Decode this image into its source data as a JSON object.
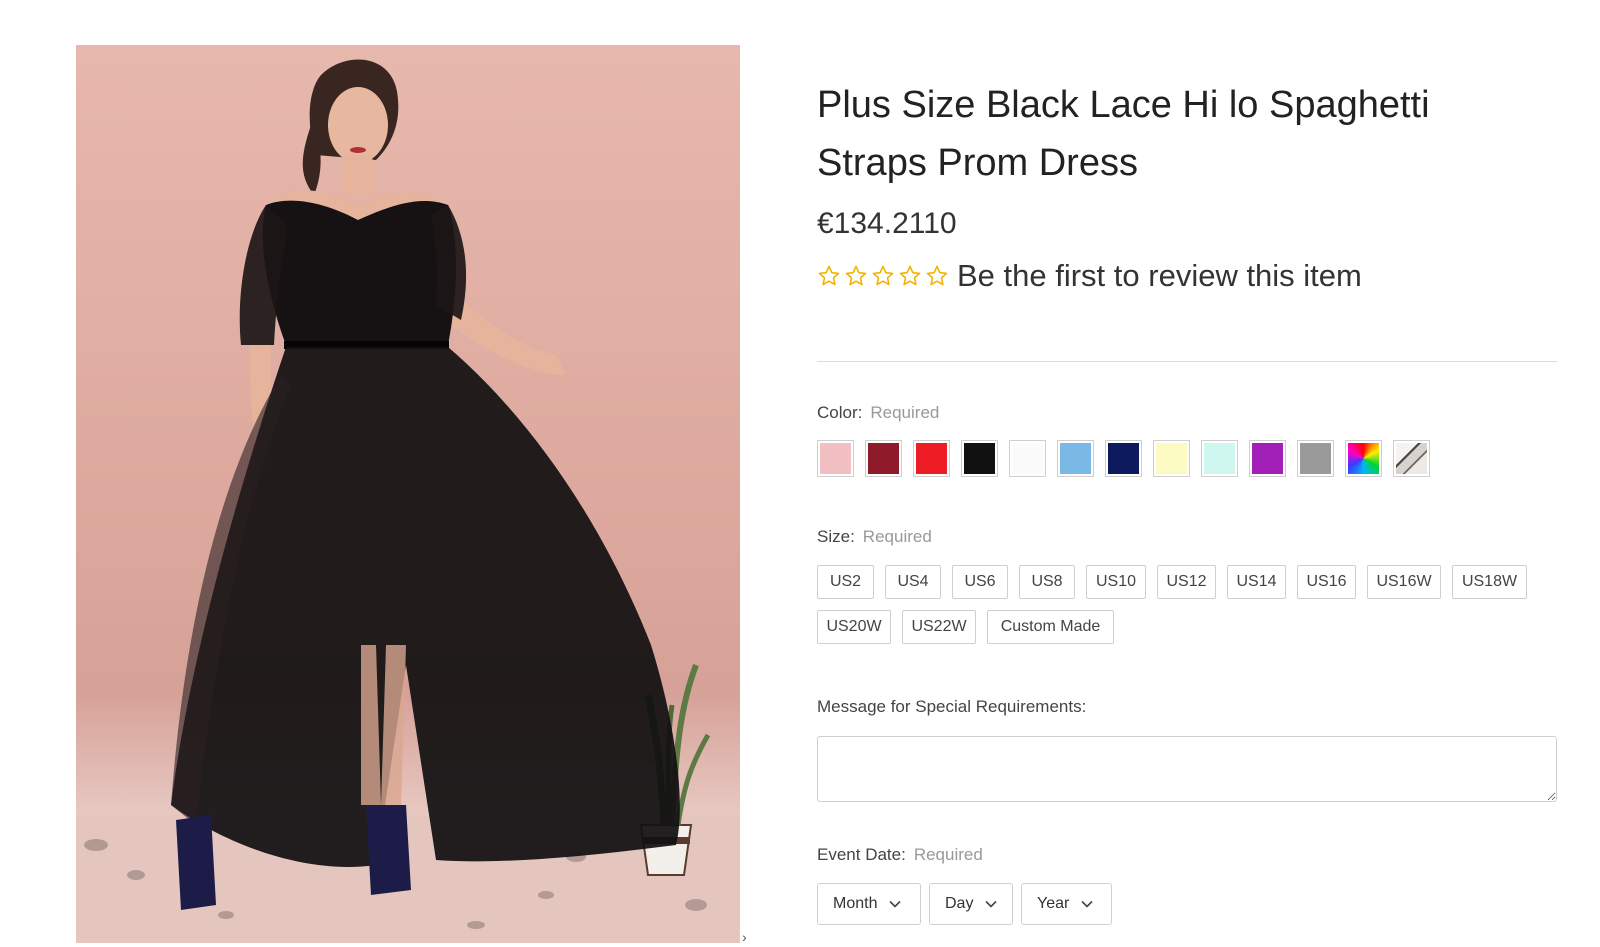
{
  "product": {
    "title": "Plus Size Black Lace Hi lo Spaghetti Straps Prom Dress",
    "price": "€134.2110",
    "review_prompt": "Be the first to review this item",
    "rating_stars": 0
  },
  "color": {
    "label": "Color:",
    "required": "Required",
    "swatches": [
      {
        "name": "pink",
        "hex": "#f2c0c3"
      },
      {
        "name": "burgundy",
        "hex": "#8e1a2a"
      },
      {
        "name": "red",
        "hex": "#ee1c24"
      },
      {
        "name": "black",
        "hex": "#111111"
      },
      {
        "name": "white",
        "hex": "#fbfbfb"
      },
      {
        "name": "light-blue",
        "hex": "#7ab8e6"
      },
      {
        "name": "navy",
        "hex": "#0d1a5e"
      },
      {
        "name": "light-yellow",
        "hex": "#fdfbc4"
      },
      {
        "name": "mint",
        "hex": "#cdf7ef"
      },
      {
        "name": "purple",
        "hex": "#a21fb8"
      },
      {
        "name": "gray",
        "hex": "#9a9a9a"
      },
      {
        "name": "multicolor",
        "hex": "#ff0000"
      },
      {
        "name": "pattern",
        "hex": "#cccccc"
      }
    ]
  },
  "size": {
    "label": "Size:",
    "required": "Required",
    "options": [
      "US2",
      "US4",
      "US6",
      "US8",
      "US10",
      "US12",
      "US14",
      "US16",
      "US16W",
      "US18W",
      "US20W",
      "US22W",
      "Custom Made"
    ]
  },
  "message": {
    "label": "Message for Special Requirements:",
    "value": ""
  },
  "event_date": {
    "label": "Event Date:",
    "required": "Required",
    "month": "Month",
    "day": "Day",
    "year": "Year"
  }
}
